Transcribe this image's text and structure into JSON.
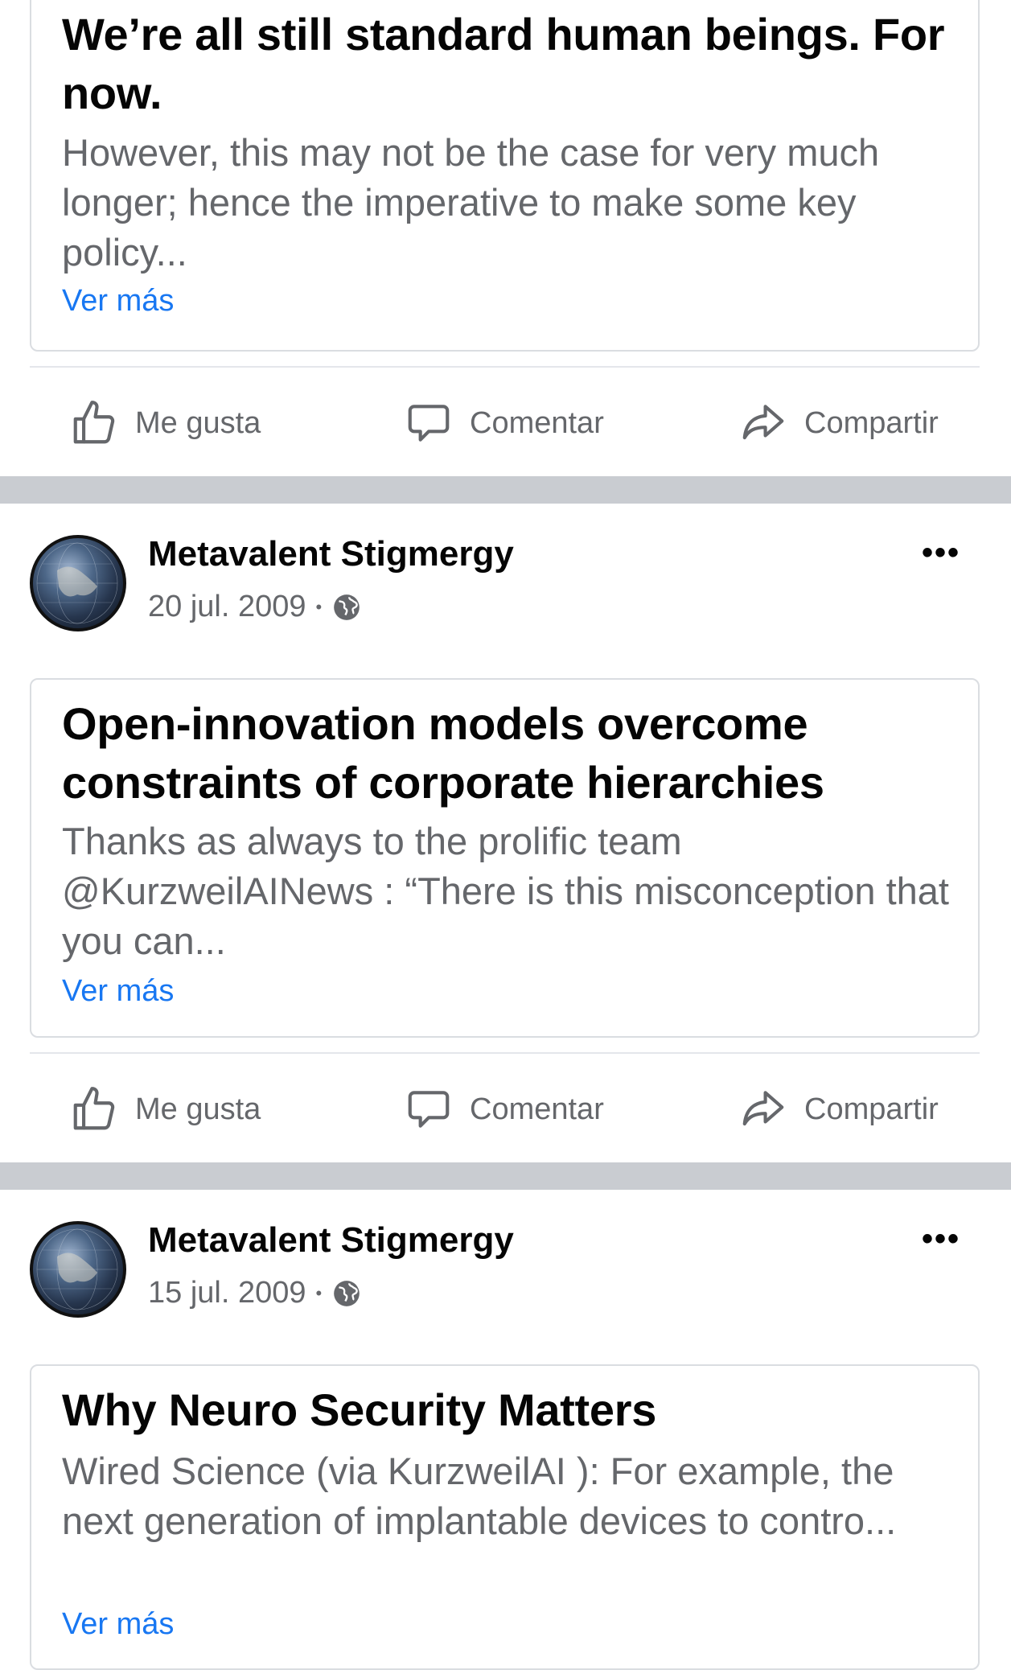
{
  "posts": [
    {
      "link_title": "We’re all still standard human beings. For now.",
      "link_desc": "However, this may not be the case for very much longer; hence the imperative to make some key policy...",
      "see_more": "Ver más"
    },
    {
      "author": "Metavalent Stigmergy",
      "date": "20 jul. 2009",
      "dot": "•",
      "link_title": "Open-innovation models overcome constraints of corporate hierarchies",
      "link_desc": "Thanks as always to the prolific team @KurzweilAINews : “There is this misconception that you can...",
      "see_more": "Ver más"
    },
    {
      "author": "Metavalent Stigmergy",
      "date": "15 jul. 2009",
      "dot": "•",
      "link_title": "Why Neuro Security Matters",
      "link_desc": "Wired Science  (via  KurzweilAI ): For example, the next generation of implantable devices to contro...",
      "see_more": "Ver más"
    }
  ],
  "actions": {
    "like": "Me gusta",
    "comment": "Comentar",
    "share": "Compartir"
  },
  "more_options": "•••",
  "icons": {
    "like": "thumbs-up-icon",
    "comment": "comment-bubble-icon",
    "share": "share-arrow-icon",
    "audience": "globe-icon",
    "menu": "more-options-icon"
  },
  "colors": {
    "link": "#1877f2",
    "secondary_text": "#65676b",
    "separator": "#c9ccd1"
  }
}
